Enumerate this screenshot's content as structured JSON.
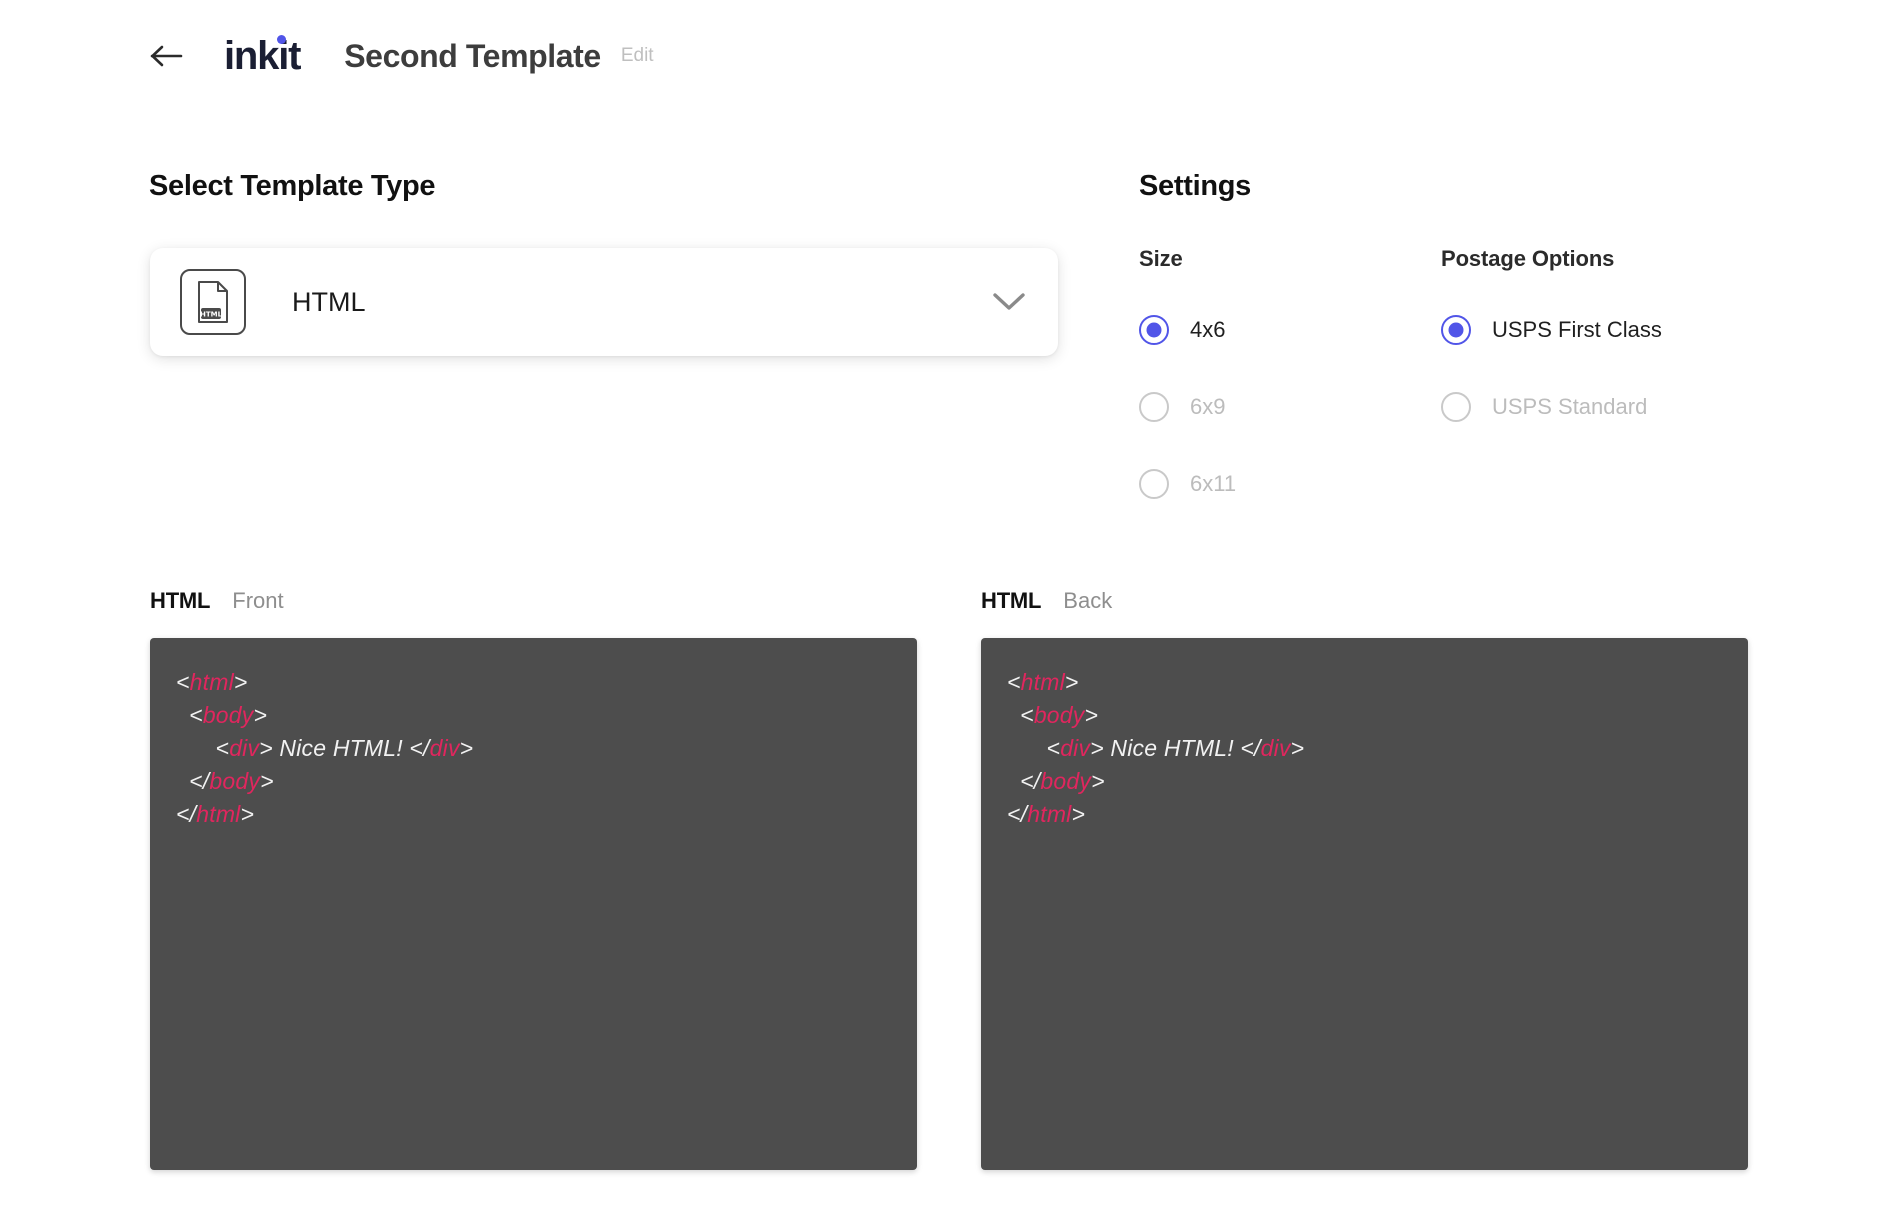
{
  "header": {
    "back_icon": "arrow-left-icon",
    "logo_text": "inkit",
    "title": "Second Template",
    "edit_label": "Edit"
  },
  "template_type": {
    "heading": "Select Template Type",
    "selected_label": "HTML",
    "icon": "html-file-icon",
    "icon_badge": "HTML",
    "chevron_icon": "chevron-down-icon"
  },
  "settings": {
    "heading": "Settings",
    "size": {
      "title": "Size",
      "options": [
        {
          "label": "4x6",
          "checked": true,
          "disabled": false
        },
        {
          "label": "6x9",
          "checked": false,
          "disabled": true
        },
        {
          "label": "6x11",
          "checked": false,
          "disabled": true
        }
      ]
    },
    "postage": {
      "title": "Postage Options",
      "options": [
        {
          "label": "USPS First Class",
          "checked": true,
          "disabled": false
        },
        {
          "label": "USPS Standard",
          "checked": false,
          "disabled": true
        }
      ]
    }
  },
  "editors": [
    {
      "lang": "HTML",
      "side": "Front",
      "code_lines": [
        [
          {
            "t": "<",
            "c": "pnc"
          },
          {
            "t": "html",
            "c": "tag"
          },
          {
            "t": ">",
            "c": "pnc"
          }
        ],
        [
          {
            "t": "  <",
            "c": "pnc"
          },
          {
            "t": "body",
            "c": "tag"
          },
          {
            "t": ">",
            "c": "pnc"
          }
        ],
        [
          {
            "t": "      <",
            "c": "pnc"
          },
          {
            "t": "div",
            "c": "tag"
          },
          {
            "t": "> Nice HTML! </",
            "c": "pnc"
          },
          {
            "t": "div",
            "c": "tag"
          },
          {
            "t": ">",
            "c": "pnc"
          }
        ],
        [
          {
            "t": "  </",
            "c": "pnc"
          },
          {
            "t": "body",
            "c": "tag"
          },
          {
            "t": ">",
            "c": "pnc"
          }
        ],
        [
          {
            "t": "</",
            "c": "pnc"
          },
          {
            "t": "html",
            "c": "tag"
          },
          {
            "t": ">",
            "c": "pnc"
          }
        ]
      ]
    },
    {
      "lang": "HTML",
      "side": "Back",
      "code_lines": [
        [
          {
            "t": "<",
            "c": "pnc"
          },
          {
            "t": "html",
            "c": "tag"
          },
          {
            "t": ">",
            "c": "pnc"
          }
        ],
        [
          {
            "t": "  <",
            "c": "pnc"
          },
          {
            "t": "body",
            "c": "tag"
          },
          {
            "t": ">",
            "c": "pnc"
          }
        ],
        [
          {
            "t": "      <",
            "c": "pnc"
          },
          {
            "t": "div",
            "c": "tag"
          },
          {
            "t": "> Nice HTML! </",
            "c": "pnc"
          },
          {
            "t": "div",
            "c": "tag"
          },
          {
            "t": ">",
            "c": "pnc"
          }
        ],
        [
          {
            "t": "  </",
            "c": "pnc"
          },
          {
            "t": "body",
            "c": "tag"
          },
          {
            "t": ">",
            "c": "pnc"
          }
        ],
        [
          {
            "t": "</",
            "c": "pnc"
          },
          {
            "t": "html",
            "c": "tag"
          },
          {
            "t": ">",
            "c": "pnc"
          }
        ]
      ]
    }
  ],
  "colors": {
    "accent_indigo": "#5155e8",
    "logo_navy": "#1a1e33",
    "editor_bg": "#4d4d4d",
    "code_tag_pink": "#e0265e",
    "muted_gray": "#bcbcbc"
  }
}
